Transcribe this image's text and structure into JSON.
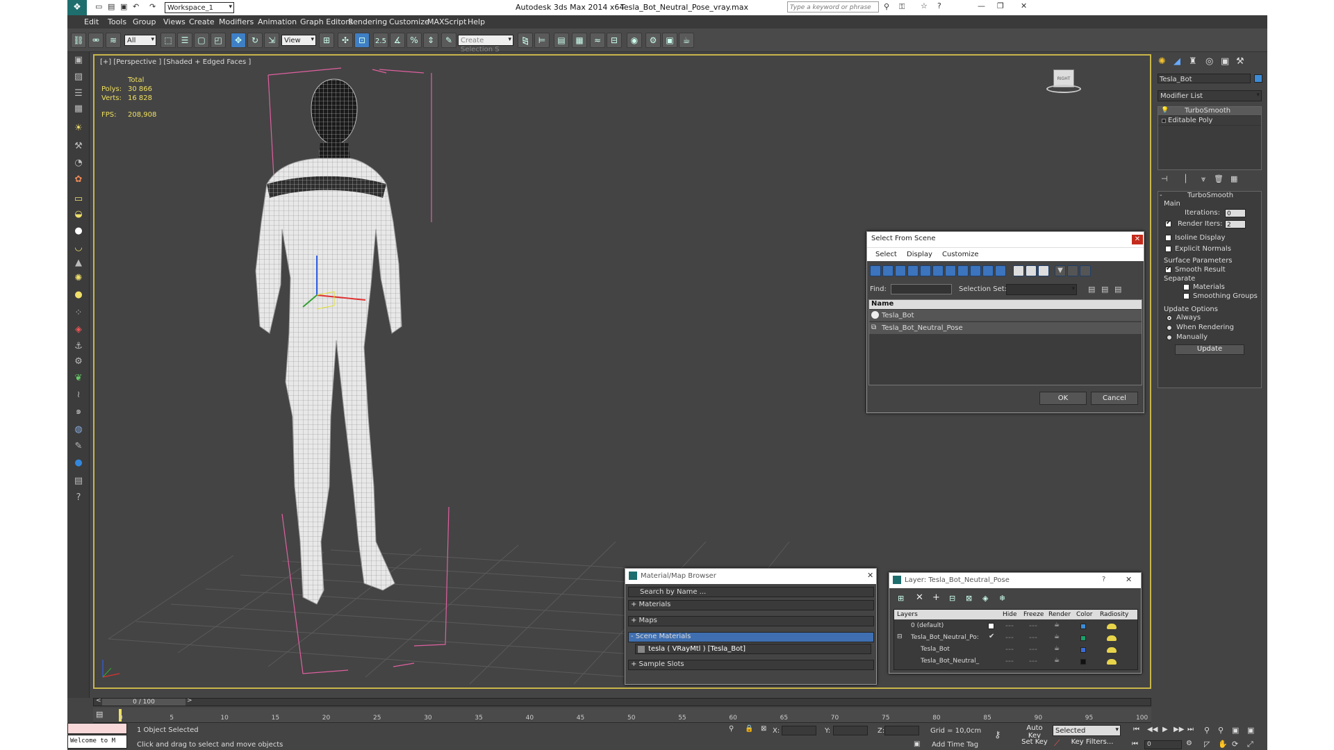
{
  "titlebar": {
    "workspace": "Workspace_1",
    "app_title": "Autodesk 3ds Max  2014 x64",
    "file": "Tesla_Bot_Neutral_Pose_vray.max",
    "search_placeholder": "Type a keyword or phrase"
  },
  "menu": [
    "Edit",
    "Tools",
    "Group",
    "Views",
    "Create",
    "Modifiers",
    "Animation",
    "Graph Editors",
    "Rendering",
    "Customize",
    "MAXScript",
    "Help"
  ],
  "toolbar": {
    "filter": "All",
    "refcoord": "View",
    "selection_set": "Create Selection S",
    "snap_angle": "2.5"
  },
  "viewport": {
    "label": "[+] [Perspective ] [Shaded + Edged Faces ]",
    "stats": {
      "total": "Total",
      "polys_label": "Polys:",
      "polys": "30 866",
      "verts_label": "Verts:",
      "verts": "16 828",
      "fps_label": "FPS:",
      "fps": "208,908"
    },
    "viewcube": "RIGHT"
  },
  "cmdpanel": {
    "object_name": "Tesla_Bot",
    "object_color": "#3c8cd8",
    "modifier_list": "Modifier List",
    "stack": [
      "TurboSmooth",
      "Editable Poly"
    ],
    "turbosmooth": {
      "title": "TurboSmooth",
      "main": "Main",
      "iterations_label": "Iterations:",
      "iterations": "0",
      "render_iters_label": "Render Iters:",
      "render_iters": "2",
      "isoline": "Isoline Display",
      "explicit": "Explicit Normals",
      "surface": "Surface Parameters",
      "smooth_result": "Smooth Result",
      "separate": "Separate",
      "materials": "Materials",
      "smoothing": "Smoothing Groups",
      "update_options": "Update Options",
      "always": "Always",
      "when_rendering": "When Rendering",
      "manually": "Manually",
      "update": "Update"
    }
  },
  "select_scene": {
    "title": "Select From Scene",
    "menu": [
      "Select",
      "Display",
      "Customize"
    ],
    "find": "Find:",
    "selection_set": "Selection Set:",
    "col_name": "Name",
    "rows": [
      "Tesla_Bot",
      "Tesla_Bot_Neutral_Pose"
    ],
    "ok": "OK",
    "cancel": "Cancel"
  },
  "material_browser": {
    "title": "Material/Map Browser",
    "search": "Search by Name ...",
    "sections": [
      "+ Materials",
      "+ Maps",
      "- Scene Materials"
    ],
    "material": "tesla  ( VRayMtl )  [Tesla_Bot]",
    "sample": "+ Sample Slots"
  },
  "layer_dialog": {
    "title": "Layer: Tesla_Bot_Neutral_Pose",
    "help": "?",
    "cols": [
      "Layers",
      "Hide",
      "Freeze",
      "Render",
      "Color",
      "Radiosity"
    ],
    "rows": [
      {
        "name": "0 (default)",
        "color": "#3c8cd8"
      },
      {
        "name": "Tesla_Bot_Neutral_Po:",
        "color": "#1aa06a"
      },
      {
        "name": "Tesla_Bot",
        "color": "#3c6cd8"
      },
      {
        "name": "Tesla_Bot_Neutral_",
        "color": "#111111"
      }
    ]
  },
  "timeline": {
    "frame": "0 / 100",
    "ticks": [
      "0",
      "5",
      "10",
      "15",
      "20",
      "25",
      "30",
      "35",
      "40",
      "45",
      "50",
      "55",
      "60",
      "65",
      "70",
      "75",
      "80",
      "85",
      "90",
      "95",
      "100"
    ]
  },
  "status": {
    "welcome": "Welcome to M",
    "selected": "1 Object Selected",
    "prompt": "Click and drag to select and move objects",
    "x": "X:",
    "y": "Y:",
    "z": "Z:",
    "grid": "Grid = 10,0cm",
    "add_time_tag": "Add Time Tag",
    "auto_key": "Auto Key",
    "set_key": "Set Key",
    "key_mode": "Selected",
    "key_filters": "Key Filters...",
    "frame_field": "0"
  }
}
